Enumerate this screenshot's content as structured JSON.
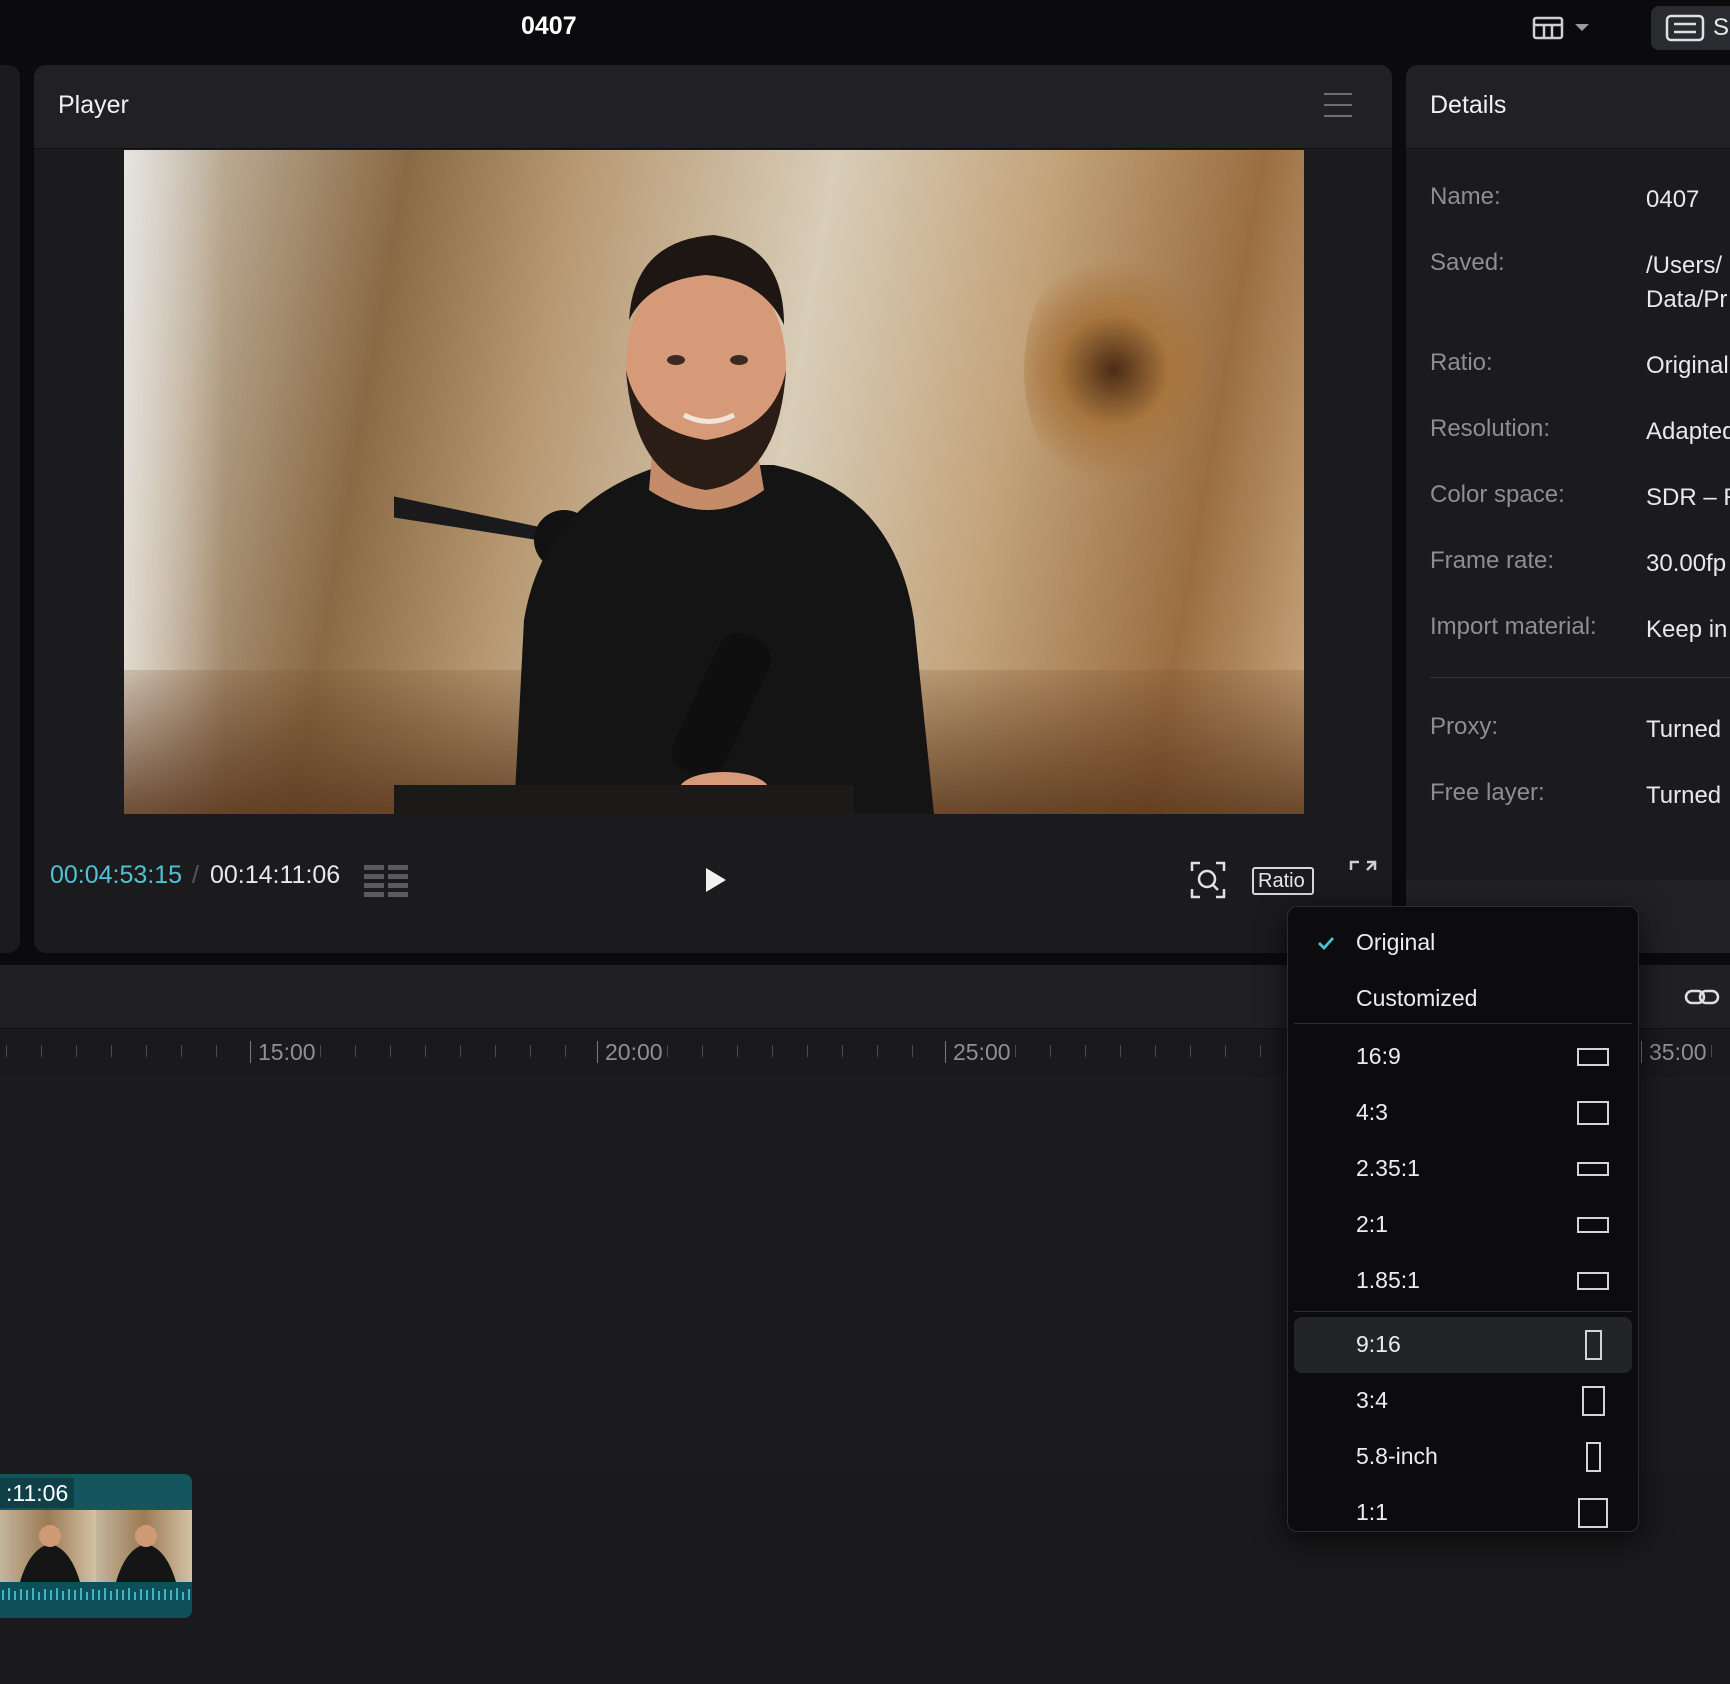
{
  "app": {
    "project_title": "0407",
    "export_label": "S"
  },
  "player": {
    "title": "Player",
    "timecode_current": "00:04:53:15",
    "timecode_separator": "/",
    "timecode_total": "00:14:11:06",
    "ratio_label": "Ratio",
    "accent_color": "#4fc3d6"
  },
  "details": {
    "title": "Details",
    "rows": [
      {
        "key": "Name:",
        "value": "0407"
      },
      {
        "key": "Saved:",
        "value": "/Users/",
        "value2": "Data/Pr"
      },
      {
        "key": "Ratio:",
        "value": "Original"
      },
      {
        "key": "Resolution:",
        "value": "Adapted"
      },
      {
        "key": "Color space:",
        "value": "SDR – R"
      },
      {
        "key": "Frame rate:",
        "value": "30.00fp"
      },
      {
        "key": "Import material:",
        "value": "Keep in"
      },
      {
        "key": "Proxy:",
        "value": "Turned"
      },
      {
        "key": "Free layer:",
        "value": "Turned"
      }
    ]
  },
  "timeline": {
    "ruler_labels": [
      "15:00",
      "20:00",
      "25:00",
      "35:00"
    ],
    "clip_duration": ":11:06"
  },
  "ratio_menu": {
    "selected": "Original",
    "hovered": "9:16",
    "items": [
      {
        "label": "Original",
        "checked": true
      },
      {
        "label": "Customized"
      },
      {
        "label": "16:9"
      },
      {
        "label": "4:3"
      },
      {
        "label": "2.35:1"
      },
      {
        "label": "2:1"
      },
      {
        "label": "1.85:1"
      },
      {
        "label": "9:16"
      },
      {
        "label": "3:4"
      },
      {
        "label": "5.8-inch"
      },
      {
        "label": "1:1"
      }
    ]
  },
  "icons": [
    "layout-icon",
    "chevron-down-icon",
    "keyboard-icon",
    "menu-icon",
    "grid-view-icon",
    "play-icon",
    "zoom-fit-icon",
    "fullscreen-icon",
    "link-icon",
    "check-icon",
    "aspect-shape-icon"
  ]
}
